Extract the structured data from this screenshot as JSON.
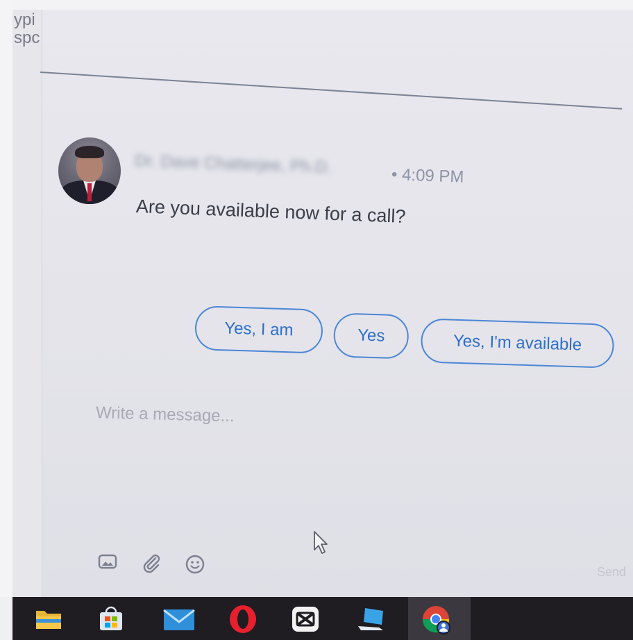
{
  "left_pane": {
    "partial_text": "ypi\nspc"
  },
  "message": {
    "sender_name": "Dr. Dave Chatterjee, Ph.D.",
    "timestamp": "• 4:09 PM",
    "text": "Are you available now for a call?"
  },
  "quick_replies": [
    {
      "label": "Yes, I am"
    },
    {
      "label": "Yes"
    },
    {
      "label": "Yes, I'm available"
    }
  ],
  "compose": {
    "placeholder": "Write a message...",
    "value": "",
    "send_label": "Send"
  },
  "toolbar": {
    "icons": [
      "image-icon",
      "attachment-icon",
      "emoji-icon"
    ]
  },
  "taskbar": {
    "apps": [
      "file-explorer-icon",
      "microsoft-store-icon",
      "mail-icon",
      "opera-icon",
      "capcut-icon",
      "laptop-app-icon",
      "chrome-profile-icon"
    ]
  },
  "colors": {
    "accent": "#2f6fc9",
    "button_border": "#4b86d6",
    "taskbar": "#1f1c22",
    "background": "#e4e4ea"
  }
}
